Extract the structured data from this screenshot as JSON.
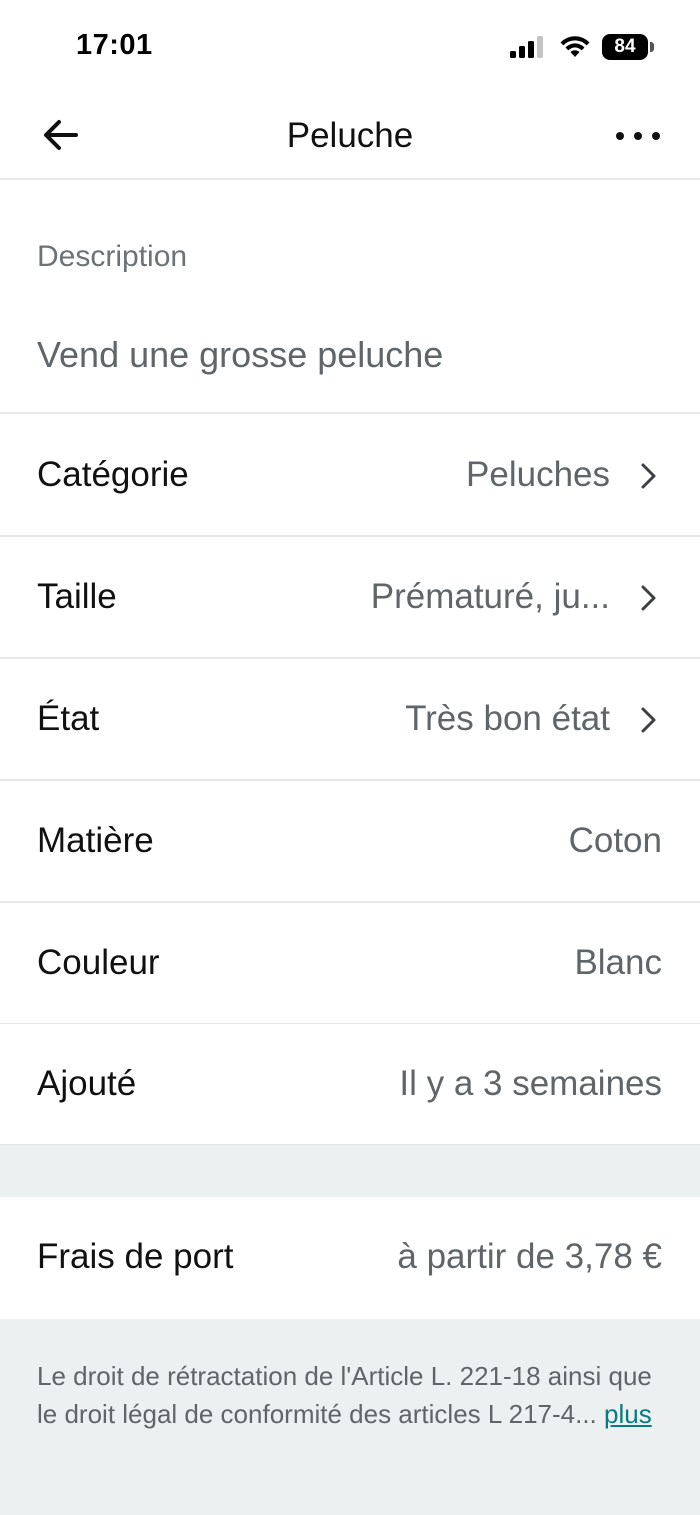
{
  "status_bar": {
    "time": "17:01",
    "battery": "84"
  },
  "nav": {
    "title": "Peluche"
  },
  "description": {
    "label": "Description",
    "text": "Vend une grosse peluche"
  },
  "details": [
    {
      "label": "Catégorie",
      "value": "Peluches"
    },
    {
      "label": "Taille",
      "value": "Prématuré, ju..."
    },
    {
      "label": "État",
      "value": "Très bon état"
    },
    {
      "label": "Matière",
      "value": "Coton"
    },
    {
      "label": "Couleur",
      "value": "Blanc"
    },
    {
      "label": "Ajouté",
      "value": "Il y a 3 semaines"
    }
  ],
  "shipping": {
    "label": "Frais de port",
    "value": "à partir de 3,78 €"
  },
  "legal": {
    "text": "Le droit de rétractation de l'Article L. 221-18 ainsi que le droit légal de conformité des articles L 217-4...",
    "more_link": "plus"
  }
}
